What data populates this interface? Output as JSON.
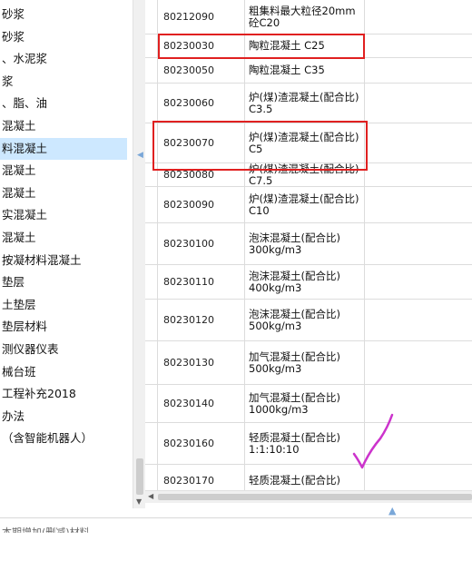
{
  "tree": {
    "items": [
      {
        "label": "砂浆",
        "selected": false
      },
      {
        "label": "砂浆",
        "selected": false
      },
      {
        "label": "、水泥浆",
        "selected": false
      },
      {
        "label": "浆",
        "selected": false
      },
      {
        "label": "、脂、油",
        "selected": false
      },
      {
        "label": "混凝土",
        "selected": false
      },
      {
        "label": "料混凝土",
        "selected": true
      },
      {
        "label": "混凝土",
        "selected": false
      },
      {
        "label": "混凝土",
        "selected": false
      },
      {
        "label": "实混凝土",
        "selected": false
      },
      {
        "label": "混凝土",
        "selected": false
      },
      {
        "label": "按凝材料混凝土",
        "selected": false
      },
      {
        "label": "垫层",
        "selected": false
      },
      {
        "label": "土垫层",
        "selected": false
      },
      {
        "label": "垫层材料",
        "selected": false
      },
      {
        "label": "测仪器仪表",
        "selected": false
      },
      {
        "label": "械台班",
        "selected": false
      },
      {
        "label": "工程补充2018",
        "selected": false
      },
      {
        "label": "办法",
        "selected": false
      },
      {
        "label": "（含智能机器人）",
        "selected": false
      }
    ]
  },
  "grid": {
    "rows": [
      {
        "code": "80212090",
        "name": "粗集料最大粒径20mm 砼C20"
      },
      {
        "code": "80230030",
        "name": "陶粒混凝土 C25"
      },
      {
        "code": "80230050",
        "name": "陶粒混凝土 C35"
      },
      {
        "code": "80230060",
        "name": "炉(煤)渣混凝土(配合比) C3.5"
      },
      {
        "code": "80230070",
        "name": "炉(煤)渣混凝土(配合比) C5"
      },
      {
        "code": "80230080",
        "name": "炉(煤)渣混凝土(配合比) C7.5"
      },
      {
        "code": "80230090",
        "name": "炉(煤)渣混凝土(配合比) C10"
      },
      {
        "code": "80230100",
        "name": "泡沫混凝土(配合比) 300kg/m3"
      },
      {
        "code": "80230110",
        "name": "泡沫混凝土(配合比) 400kg/m3"
      },
      {
        "code": "80230120",
        "name": "泡沫混凝土(配合比) 500kg/m3"
      },
      {
        "code": "80230130",
        "name": "加气混凝土(配合比) 500kg/m3"
      },
      {
        "code": "80230140",
        "name": "加气混凝土(配合比) 1000kg/m3"
      },
      {
        "code": "80230160",
        "name": "轻质混凝土(配合比) 1:1:10:10"
      },
      {
        "code": "80230170",
        "name": "轻质混凝土(配合比)"
      }
    ]
  },
  "footer": {
    "text": "本期增加(删减)材料"
  },
  "colors": {
    "highlight": "#e02020",
    "selected_row": "#cde8ff",
    "check_mark": "#cc33cc"
  }
}
